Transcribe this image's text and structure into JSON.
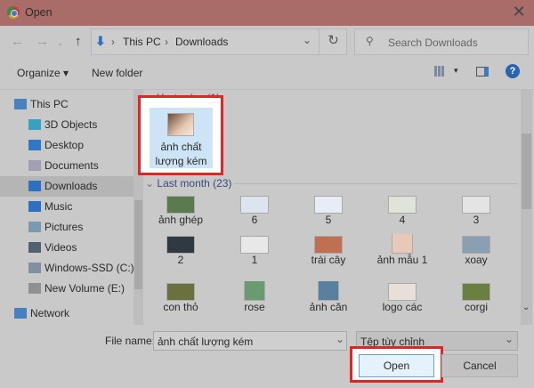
{
  "window": {
    "title": "Open",
    "close_icon": "close-icon",
    "app_icon": "chrome-icon"
  },
  "address": {
    "crumbs": [
      "This PC",
      "Downloads"
    ],
    "search_placeholder": "Search Downloads"
  },
  "toolbar": {
    "organize": "Organize ▾",
    "new_folder": "New folder"
  },
  "sidebar": {
    "items": [
      {
        "label": "This PC",
        "icon": "computer-icon"
      },
      {
        "label": "3D Objects",
        "icon": "cube-icon"
      },
      {
        "label": "Desktop",
        "icon": "desktop-icon"
      },
      {
        "label": "Documents",
        "icon": "documents-icon"
      },
      {
        "label": "Downloads",
        "icon": "download-icon",
        "selected": true
      },
      {
        "label": "Music",
        "icon": "music-icon"
      },
      {
        "label": "Pictures",
        "icon": "pictures-icon"
      },
      {
        "label": "Videos",
        "icon": "videos-icon"
      },
      {
        "label": "Windows-SSD (C:)",
        "icon": "drive-icon"
      },
      {
        "label": "New Volume (E:)",
        "icon": "drive-icon"
      },
      {
        "label": "Network",
        "icon": "network-icon"
      }
    ]
  },
  "groups": [
    {
      "header": "Yesterday (1)",
      "files": [
        "ảnh chất lượng kém"
      ]
    },
    {
      "header": "Last month (23)",
      "files": [
        "ảnh ghép",
        "6",
        "5",
        "4",
        "3",
        "2",
        "1",
        "trái cây",
        "ảnh mẫu 1",
        "xoay",
        "con thỏ",
        "rose",
        "ảnh căn",
        "logo các",
        "corgi"
      ]
    }
  ],
  "footer": {
    "file_name_label": "File name:",
    "file_name_value": "ảnh chất lượng kém",
    "file_type": "Tệp tùy chỉnh",
    "open": "Open",
    "cancel": "Cancel"
  },
  "colors": {
    "highlight": "#e02525",
    "selected": "#cce4f5"
  }
}
